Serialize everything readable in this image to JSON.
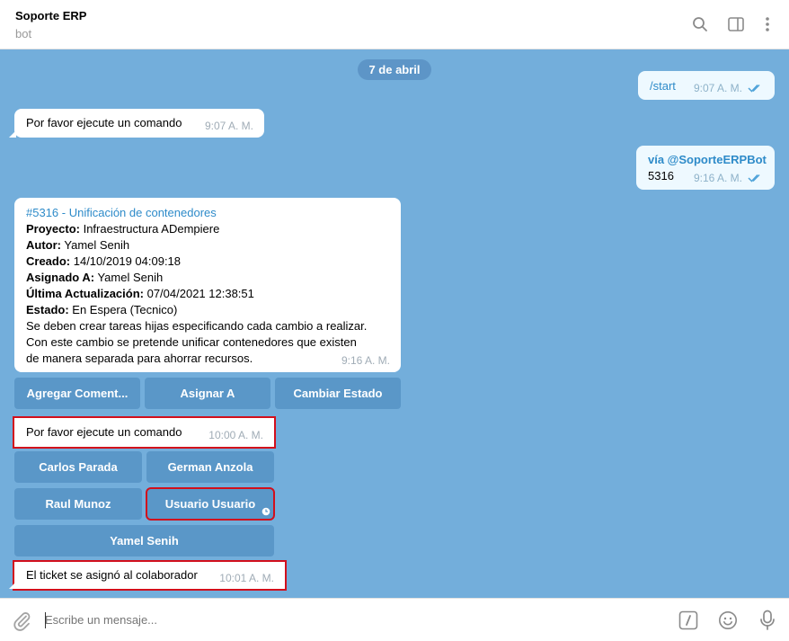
{
  "header": {
    "title": "Soporte ERP",
    "subtitle": "bot"
  },
  "icons": {
    "search": "search-icon",
    "sidebar": "sidebar-toggle-icon",
    "more": "more-vertical-icon",
    "attach": "paperclip-icon",
    "commands": "slash-command-icon",
    "emoji": "smile-icon",
    "mic": "microphone-icon",
    "read": "double-check-icon",
    "pending": "clock-icon"
  },
  "colors": {
    "chat_bg": "#73aedb",
    "button": "#5a97c8",
    "highlight": "#d20f1c",
    "link": "#2e8bc9"
  },
  "chat": {
    "date": "7 de abril",
    "msg_start": {
      "text": "/start",
      "time": "9:07 A. M."
    },
    "msg_run1": {
      "text": "Por favor ejecute un comando",
      "time": "9:07 A. M."
    },
    "msg_via": {
      "via": "vía @SoporteERPBot",
      "text": "5316",
      "time": "9:16 A. M."
    },
    "ticket": {
      "title": "#5316 - Unificación de contenedores",
      "fields": [
        {
          "label": "Proyecto:",
          "value": " Infraestructura ADempiere"
        },
        {
          "label": "Autor:",
          "value": " Yamel Senih"
        },
        {
          "label": "Creado:",
          "value": " 14/10/2019 04:09:18"
        },
        {
          "label": "Asignado A:",
          "value": " Yamel Senih"
        },
        {
          "label": "Última Actualización:",
          "value": " 07/04/2021 12:38:51"
        },
        {
          "label": "Estado:",
          "value": " En Espera (Tecnico)"
        }
      ],
      "description": [
        "Se deben crear tareas hijas especificando cada cambio a realizar.",
        "Con este cambio se pretende unificar contenedores que existen",
        "de manera separada para ahorrar recursos."
      ],
      "time": "9:16 A. M.",
      "buttons": [
        "Agregar Coment...",
        "Asignar A",
        "Cambiar Estado"
      ]
    },
    "msg_run2": {
      "text": "Por favor ejecute un comando",
      "time": "10:00 A. M."
    },
    "assign_buttons": [
      "Carlos Parada",
      "German Anzola",
      "Raul Munoz",
      "Usuario Usuario",
      "Yamel Senih"
    ],
    "msg_assigned": {
      "text": "El ticket se asignó al colaborador",
      "time": "10:01 A. M."
    }
  },
  "composer": {
    "placeholder": "Escribe un mensaje..."
  }
}
